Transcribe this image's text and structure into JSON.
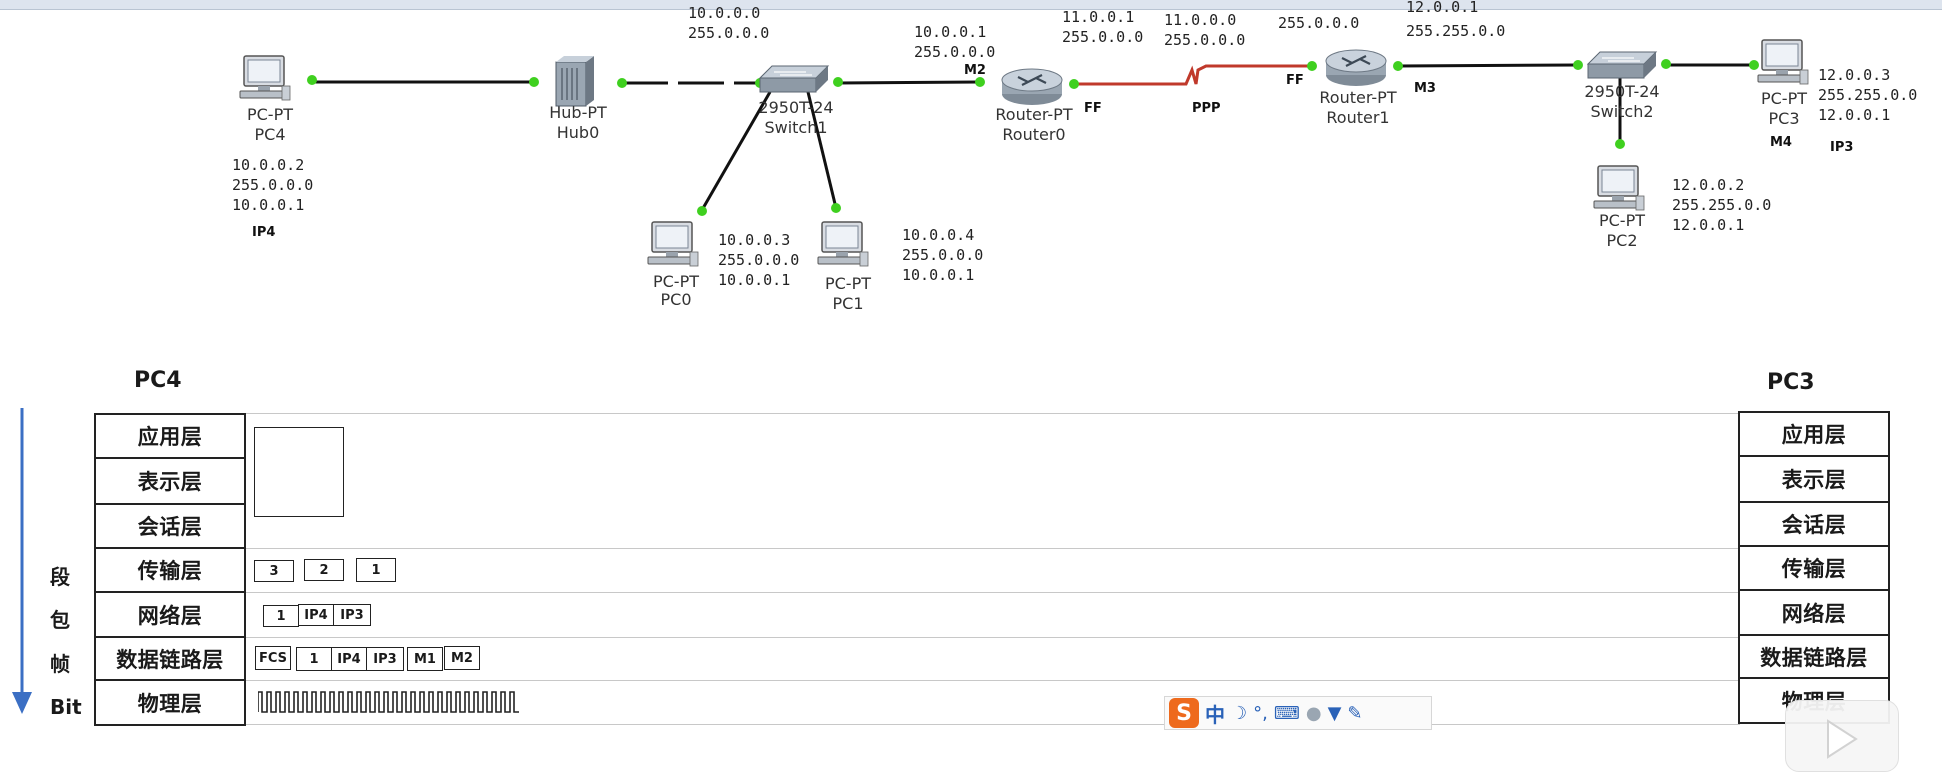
{
  "colors": {
    "link": "#111111",
    "serial_link": "#c0392b",
    "port_dot": "#3fd01f",
    "arrow": "#3b6fc4"
  },
  "devices": {
    "pc4": {
      "type": "PC-PT",
      "name": "PC4",
      "ip": "10.0.0.2",
      "mask": "255.0.0.0",
      "gateway": "10.0.0.1",
      "tag": "IP4"
    },
    "hub0": {
      "type": "Hub-PT",
      "name": "Hub0"
    },
    "switch1": {
      "type": "2950T-24",
      "name": "Switch1",
      "net": "10.0.0.0",
      "mask": "255.0.0.0"
    },
    "pc0": {
      "type": "PC-PT",
      "name": "PC0",
      "ip": "10.0.0.3",
      "mask": "255.0.0.0",
      "gateway": "10.0.0.1"
    },
    "pc1": {
      "type": "PC-PT",
      "name": "PC1",
      "ip": "10.0.0.4",
      "mask": "255.0.0.0",
      "gateway": "10.0.0.1"
    },
    "router0": {
      "type": "Router-PT",
      "name": "Router0",
      "lan_ip": "10.0.0.1",
      "lan_mask": "255.0.0.0",
      "wan_ip": "11.0.0.1",
      "wan_mask": "255.0.0.0",
      "lan_tag": "M2",
      "wan_tag": "FF"
    },
    "ppp_link": {
      "net": "11.0.0.0",
      "mask": "255.0.0.0",
      "tag": "PPP"
    },
    "router1": {
      "type": "Router-PT",
      "name": "Router1",
      "wan_mask": "255.0.0.0",
      "lan_ip": "12.0.0.1",
      "lan_mask": "255.255.0.0",
      "wan_tag": "FF",
      "lan_tag": "M3"
    },
    "switch2": {
      "type": "2950T-24",
      "name": "Switch2"
    },
    "pc3": {
      "type": "PC-PT",
      "name": "PC3",
      "ip": "12.0.0.3",
      "mask": "255.255.0.0",
      "gateway": "12.0.0.1",
      "tag": "M4",
      "tag2": "IP3"
    },
    "pc2": {
      "type": "PC-PT",
      "name": "PC2",
      "ip": "12.0.0.2",
      "mask": "255.255.0.0",
      "gateway": "12.0.0.1"
    }
  },
  "stacks": {
    "left_title": "PC4",
    "right_title": "PC3",
    "layers": [
      "应用层",
      "表示层",
      "会话层",
      "传输层",
      "网络层",
      "数据链路层",
      "物理层"
    ]
  },
  "side_labels": [
    "段",
    "包",
    "帧",
    "Bit"
  ],
  "encapsulation": {
    "transport_segments": [
      "3",
      "2",
      "1"
    ],
    "network_packet": [
      "1",
      "IP4",
      "IP3"
    ],
    "frame": [
      "FCS",
      "1",
      "IP4",
      "IP3",
      "M1",
      "M2"
    ]
  },
  "ime": {
    "logo": "S",
    "mode": "中"
  }
}
